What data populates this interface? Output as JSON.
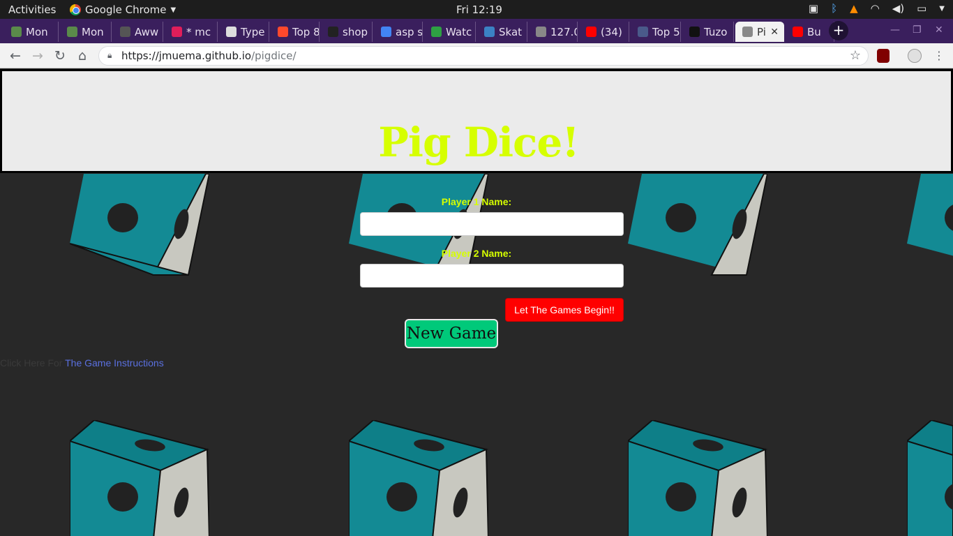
{
  "system_bar": {
    "activities": "Activities",
    "app_name": "Google Chrome",
    "clock": "Fri 12:19"
  },
  "tabs": [
    {
      "label": "Mon",
      "icon": "tree-icon",
      "color": "#5a8a4a"
    },
    {
      "label": "Mon",
      "icon": "tree-icon",
      "color": "#5a8a4a"
    },
    {
      "label": "Aww",
      "icon": "w-icon",
      "color": "#555555"
    },
    {
      "label": "* mc",
      "icon": "slack-icon",
      "color": "#e01e5a"
    },
    {
      "label": "Type",
      "icon": "typeform-icon",
      "color": "#dddddd"
    },
    {
      "label": "Top 8",
      "icon": "g2-icon",
      "color": "#ff492c"
    },
    {
      "label": "shop",
      "icon": "github-icon",
      "color": "#222222"
    },
    {
      "label": "asp s",
      "icon": "google-icon",
      "color": "#4285f4"
    },
    {
      "label": "Watc",
      "icon": "play-icon",
      "color": "#2ea043"
    },
    {
      "label": "Skat",
      "icon": "skate-icon",
      "color": "#3b82c4"
    },
    {
      "label": "127.0",
      "icon": "globe-icon",
      "color": "#888888"
    },
    {
      "label": "(34)",
      "icon": "youtube-icon",
      "color": "#ff0000"
    },
    {
      "label": "Top 5",
      "icon": "terminal-icon",
      "color": "#4a5a8a"
    },
    {
      "label": "Tuzo",
      "icon": "person-icon",
      "color": "#111111"
    },
    {
      "label": "Pi",
      "icon": "globe-icon",
      "color": "#888888",
      "active": true
    },
    {
      "label": "Bu",
      "icon": "youtube-icon",
      "color": "#ff0000"
    }
  ],
  "address_bar": {
    "url_host": "https://jmuema.github.io",
    "url_path": "/pigdice/"
  },
  "page": {
    "title": "Pig Dice!",
    "player1_label": "Player 1 Name:",
    "player2_label": "Player 2 Name:",
    "player1_value": "",
    "player2_value": "",
    "begin_button": "Let The Games Begin!!",
    "new_game_button": "New Game",
    "instructions_prefix": "Click Here For",
    "instructions_link": "The Game Instructions"
  },
  "colors": {
    "accent_yellow": "#d6ff00",
    "begin_red": "#ff0000",
    "new_game_green": "#00c97a",
    "die_teal": "#138a94",
    "die_side": "#c8c8c0"
  }
}
